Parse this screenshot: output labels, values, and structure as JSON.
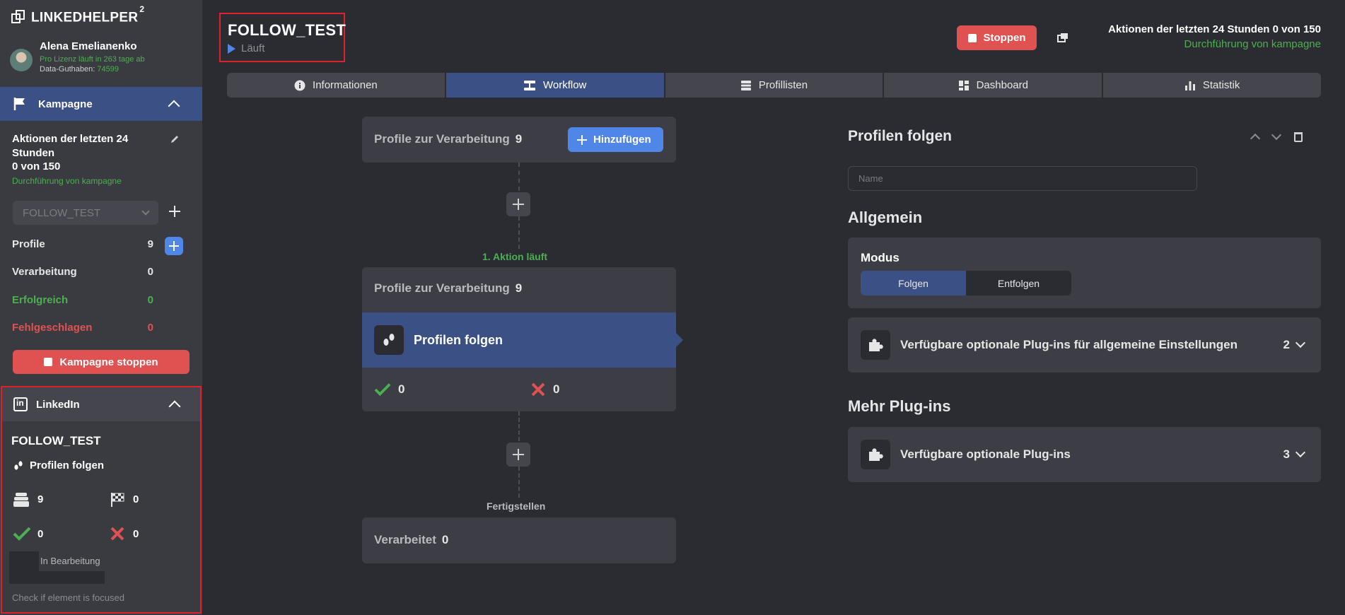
{
  "app": {
    "logo": "LINKEDHELPER",
    "logo_sup": "2"
  },
  "user": {
    "name": "Alena Emelianenko",
    "license": "Pro Lizenz läuft in 263 tage ab",
    "data_label": "Data-Guthaben:",
    "data_value": "74599"
  },
  "sidebar": {
    "campaign_header": "Kampagne",
    "actions_title": "Aktionen der letzten 24 Stunden",
    "actions_count": "0 von 150",
    "actions_status": "Durchführung von kampagne",
    "campaign_select_value": "FOLLOW_TEST",
    "stats": [
      {
        "label": "Profile",
        "value": "9",
        "color": "#ffffff"
      },
      {
        "label": "Verarbeitung",
        "value": "0",
        "color": "#ffffff"
      },
      {
        "label": "Erfolgreich",
        "value": "0",
        "color": "#4caf50"
      },
      {
        "label": "Fehlgeschlagen",
        "value": "0",
        "color": "#e05252"
      }
    ],
    "stop_campaign": "Kampagne stoppen"
  },
  "linkedin": {
    "header": "LinkedIn",
    "campaign": "FOLLOW_TEST",
    "action": "Profilen folgen",
    "queue": "9",
    "finished": "0",
    "success": "0",
    "failed": "0",
    "status": "In Bearbeitung",
    "focus_hint": "Check if element is focused"
  },
  "header": {
    "title": "FOLLOW_TEST",
    "status": "Läuft",
    "stop_label": "Stoppen",
    "actions_summary": "Aktionen der letzten 24 Stunden 0 von 150",
    "run_status": "Durchführung von kampagne"
  },
  "tabs": [
    {
      "label": "Informationen",
      "icon": "info-icon"
    },
    {
      "label": "Workflow",
      "icon": "workflow-icon",
      "active": true
    },
    {
      "label": "Profillisten",
      "icon": "list-icon"
    },
    {
      "label": "Dashboard",
      "icon": "dashboard-icon"
    },
    {
      "label": "Statistik",
      "icon": "chart-icon"
    }
  ],
  "workflow": {
    "queue_label": "Profile zur Verarbeitung",
    "queue_count": "9",
    "add_label": "Hinzufügen",
    "step_label": "1. Aktion läuft",
    "step_queue_label": "Profile zur Verarbeitung",
    "step_queue_count": "9",
    "action_label": "Profilen folgen",
    "success": "0",
    "failed": "0",
    "finish_label": "Fertigstellen",
    "processed_label": "Verarbeitet",
    "processed_count": "0"
  },
  "panel": {
    "title": "Profilen folgen",
    "name_placeholder": "Name",
    "general_heading": "Allgemein",
    "mode_label": "Modus",
    "mode_options": [
      "Folgen",
      "Entfolgen"
    ],
    "mode_selected": "Folgen",
    "plugins_general_label": "Verfügbare optionale Plug-ins für allgemeine Einstellungen",
    "plugins_general_count": "2",
    "more_heading": "Mehr Plug-ins",
    "plugins_label": "Verfügbare optionale Plug-ins",
    "plugins_count": "3"
  },
  "colors": {
    "accent_blue": "#4f86e8",
    "active_nav": "#3b5084",
    "danger": "#e05252",
    "success": "#4caf50"
  }
}
